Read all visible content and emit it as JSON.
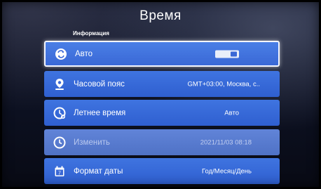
{
  "page": {
    "title": "Время"
  },
  "section": {
    "label": "Информация"
  },
  "rows": [
    {
      "label": "Авто",
      "value": "",
      "icon": "auto-sync-icon",
      "focused": true,
      "dim": false,
      "control": "toggle",
      "toggle_on": true
    },
    {
      "label": "Часовой пояс",
      "value": "GMT+03:00, Москва, с..",
      "icon": "location-pin-icon",
      "focused": false,
      "dim": false
    },
    {
      "label": "Летнее время",
      "value": "Авто",
      "icon": "summer-time-clock-icon",
      "focused": false,
      "dim": false
    },
    {
      "label": "Изменить",
      "value": "2021/11/03 08:18",
      "icon": "clock-icon",
      "focused": false,
      "dim": true
    },
    {
      "label": "Формат даты",
      "value": "Год/Месяц/День",
      "icon": "calendar-icon",
      "focused": false,
      "dim": false
    }
  ],
  "colors": {
    "row_bg": "#3a6ad8",
    "row_dim_bg": "#587cd0",
    "focus_border": "#f4f6ff",
    "text": "#ffffff",
    "background": "#0c1020"
  }
}
